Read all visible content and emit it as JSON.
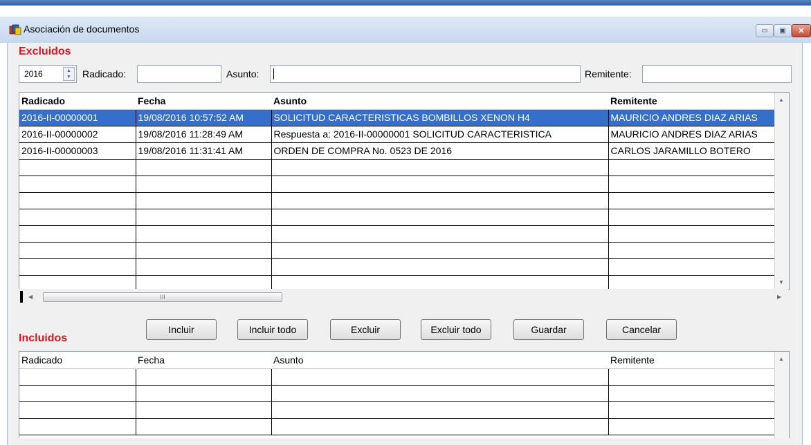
{
  "window": {
    "title": "Asociación de documentos",
    "minimize_glyph": "▭",
    "maximize_glyph": "▣",
    "close_glyph": "✕"
  },
  "excluidos": {
    "label": "Excluidos",
    "filters": {
      "year": "2016",
      "radicado_label": "Radicado:",
      "radicado_value": "",
      "asunto_label": "Asunto:",
      "asunto_value": "",
      "remitente_label": "Remitente:",
      "remitente_value": ""
    },
    "columns": [
      "Radicado",
      "Fecha",
      "Asunto",
      "Remitente"
    ],
    "rows": [
      [
        "2016-II-00000001",
        "19/08/2016 10:57:52 AM",
        "SOLICITUD CARACTERISTICAS BOMBILLOS XENON H4",
        "MAURICIO ANDRES DIAZ ARIAS"
      ],
      [
        "2016-II-00000002",
        "19/08/2016 11:28:49 AM",
        "Respuesta a: 2016-II-00000001 SOLICITUD CARACTERISTICA",
        "MAURICIO ANDRES DIAZ ARIAS"
      ],
      [
        "2016-II-00000003",
        "19/08/2016 11:31:41 AM",
        "ORDEN DE COMPRA No. 0523 DE 2016",
        "CARLOS JARAMILLO BOTERO"
      ]
    ],
    "selected_row": 0,
    "scroll_thumb_glyph": "III"
  },
  "buttons": {
    "incluir": "Incluir",
    "incluir_todo": "Incluir todo",
    "excluir": "Excluir",
    "excluir_todo": "Excluir todo",
    "guardar": "Guardar",
    "cancelar": "Cancelar"
  },
  "incluidos": {
    "label": "Incluidos",
    "columns": [
      "Radicado",
      "Fecha",
      "Asunto",
      "Remitente"
    ],
    "rows": []
  },
  "colors": {
    "section_label": "#e0141e",
    "selection": "#3470c9"
  },
  "icons": {
    "app": "documents-app-icon",
    "spinner": "spinner-arrows-icon",
    "scroll_up": "scroll-up-arrow-icon",
    "scroll_down": "scroll-down-arrow-icon",
    "scroll_left": "scroll-left-arrow-icon",
    "scroll_right": "scroll-right-arrow-icon"
  }
}
